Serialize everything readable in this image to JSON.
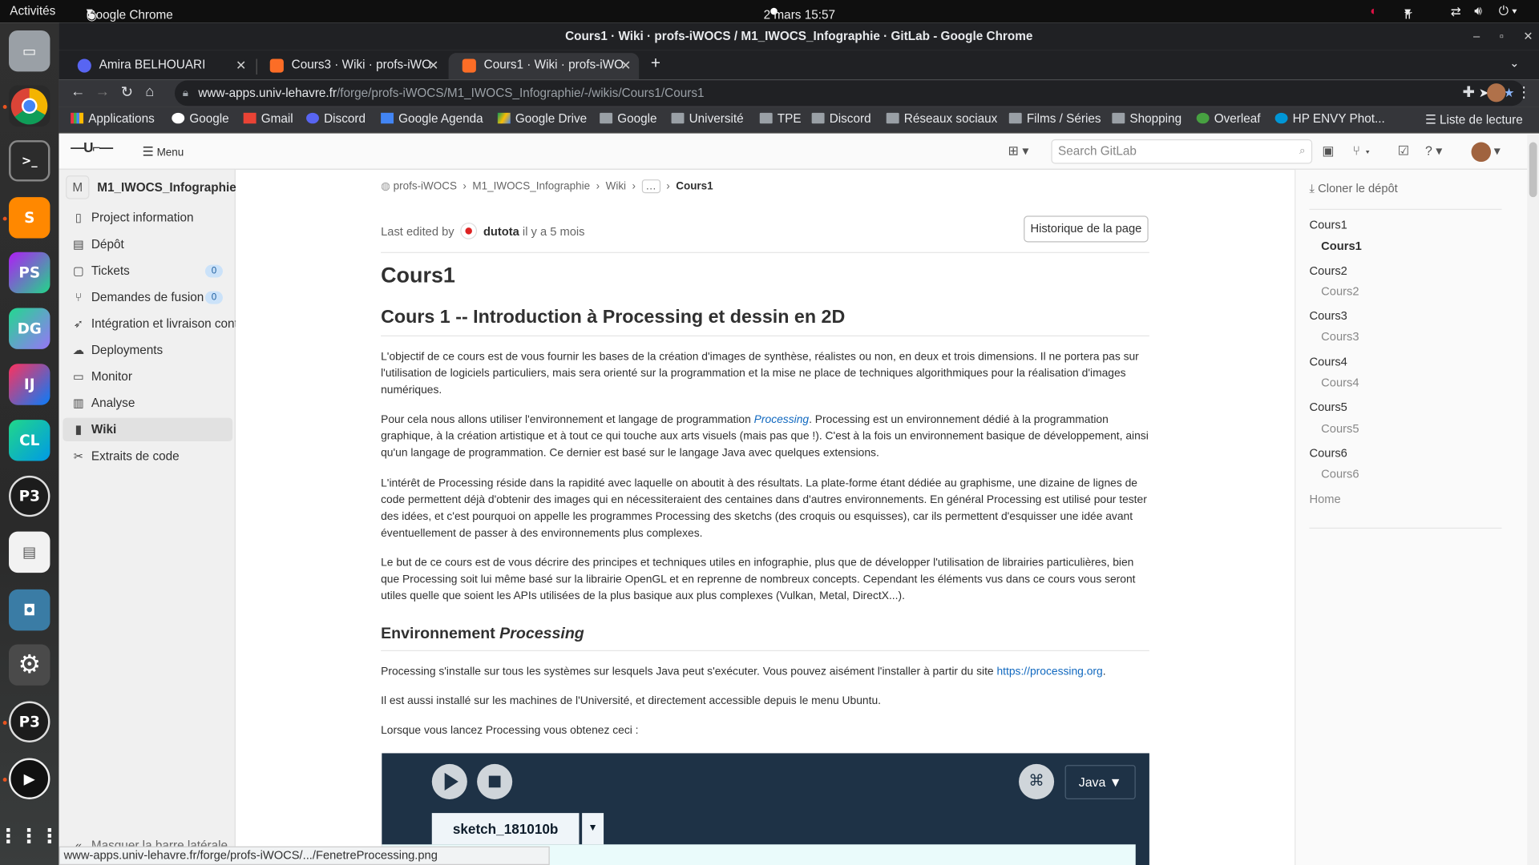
{
  "system": {
    "activities": "Activités",
    "app_menu": "Google Chrome",
    "clock": "2 mars  15:57",
    "lang": "fr"
  },
  "window": {
    "title": "Cours1 · Wiki · profs-iWOCS / M1_IWOCS_Infographie · GitLab - Google Chrome"
  },
  "tabs": [
    {
      "label": "Amira BELHOUARI",
      "favicon_color": "#5865f2"
    },
    {
      "label": "Cours3 · Wiki · profs-iWO",
      "favicon_color": "#fc6d26"
    },
    {
      "label": "Cours1 · Wiki · profs-iWO",
      "favicon_color": "#fc6d26"
    }
  ],
  "omnibox": {
    "domain": "www-apps.univ-lehavre.fr",
    "path": "/forge/profs-iWOCS/M1_IWOCS_Infographie/-/wikis/Cours1/Cours1"
  },
  "bookmarks": [
    {
      "label": "Applications",
      "icon": "apps-grid-icon"
    },
    {
      "label": "Google",
      "icon": "google-icon"
    },
    {
      "label": "Gmail",
      "icon": "gmail-icon"
    },
    {
      "label": "Discord",
      "icon": "discord-icon"
    },
    {
      "label": "Google Agenda",
      "icon": "calendar-icon"
    },
    {
      "label": "Google Drive",
      "icon": "drive-icon"
    },
    {
      "label": "Google",
      "icon": "folder-icon"
    },
    {
      "label": "Université",
      "icon": "folder-icon"
    },
    {
      "label": "TPE",
      "icon": "folder-icon"
    },
    {
      "label": "Discord",
      "icon": "folder-icon"
    },
    {
      "label": "Réseaux sociaux",
      "icon": "folder-icon"
    },
    {
      "label": "Films / Séries",
      "icon": "folder-icon"
    },
    {
      "label": "Shopping",
      "icon": "folder-icon"
    },
    {
      "label": "Overleaf",
      "icon": "overleaf-icon"
    },
    {
      "label": "HP ENVY Phot...",
      "icon": "hp-icon"
    }
  ],
  "reading_list": "Liste de lecture",
  "gitlab": {
    "menu_label": "Menu",
    "search_placeholder": "Search GitLab"
  },
  "sidebar": {
    "project_initial": "M",
    "project_name": "M1_IWOCS_Infographie",
    "items": [
      {
        "label": "Project information",
        "icon": "info-icon"
      },
      {
        "label": "Dépôt",
        "icon": "repository-icon"
      },
      {
        "label": "Tickets",
        "icon": "issues-icon",
        "count": "0"
      },
      {
        "label": "Demandes de fusion",
        "icon": "merge-request-icon",
        "count": "0"
      },
      {
        "label": "Intégration et livraison continue",
        "icon": "rocket-icon"
      },
      {
        "label": "Deployments",
        "icon": "deployments-icon"
      },
      {
        "label": "Monitor",
        "icon": "monitor-icon"
      },
      {
        "label": "Analyse",
        "icon": "chart-icon"
      },
      {
        "label": "Wiki",
        "icon": "book-icon"
      },
      {
        "label": "Extraits de code",
        "icon": "snippet-icon"
      }
    ],
    "collapse_label": "Masquer la barre latérale"
  },
  "breadcrumb": [
    "profs-iWOCS",
    "M1_IWOCS_Infographie",
    "Wiki",
    "Cours1"
  ],
  "last_edit": {
    "prefix": "Last edited by",
    "author": "dutota",
    "when": "il y a 5 mois"
  },
  "history_button": "Historique de la page",
  "content": {
    "page_title": "Cours1",
    "h2": "Cours 1 -- Introduction à Processing et dessin en 2D",
    "p1": "L'objectif de ce cours est de vous fournir les bases de la création d'images de synthèse, réalistes ou non, en deux et trois dimensions. Il ne portera pas sur l'utilisation de logiciels particuliers, mais sera orienté sur la programmation et la mise ne place de techniques algorithmiques pour la réalisation d'images numériques.",
    "p2_before": "Pour cela nous allons utiliser l'environnement et langage de programmation ",
    "p2_link": "Processing",
    "p2_after": ". Processing est un environnement dédié à la programmation graphique, à la création artistique et à tout ce qui touche aux arts visuels (mais pas que !). C'est à la fois un environnement basique de développement, ainsi qu'un langage de programmation. Ce dernier est basé sur le langage Java avec quelques extensions.",
    "p3": "L'intérêt de Processing réside dans la rapidité avec laquelle on aboutit à des résultats. La plate-forme étant dédiée au graphisme, une dizaine de lignes de code permettent déjà d'obtenir des images qui en nécessiteraient des centaines dans d'autres environnements. En général Processing est utilisé pour tester des idées, et c'est pourquoi on appelle les programmes Processing des sketchs (des croquis ou esquisses), car ils permettent d'esquisser une idée avant éventuellement de passer à des environnements plus complexes.",
    "p4": "Le but de ce cours est de vous décrire des principes et techniques utiles en infographie, plus que de développer l'utilisation de librairies particulières, bien que Processing soit lui même basé sur la librairie OpenGL et en reprenne de nombreux concepts. Cependant les éléments vus dans ce cours vous seront utiles quelle que soient les APIs utilisées de la plus basique aux plus complexes (Vulkan, Metal, DirectX...).",
    "h3_plain": "Environnement ",
    "h3_italic": "Processing",
    "p5_before": "Processing s'installe sur tous les systèmes sur lesquels Java peut s'exécuter. Vous pouvez aisément l'installer à partir du site ",
    "p5_link": "https://processing.org",
    "p5_after": ".",
    "p6": "Il est aussi installé sur les machines de l'Université, et directement accessible depuis le menu Ubuntu.",
    "p7": "Lorsque vous lancez Processing vous obtenez ceci :"
  },
  "sketch": {
    "tab_name": "sketch_181010b",
    "mode": "Java ▼"
  },
  "right_panel": {
    "clone": "Cloner le dépôt",
    "pages": [
      {
        "title": "Cours1",
        "sub": "Cours1"
      },
      {
        "title": "Cours2",
        "sub": "Cours2"
      },
      {
        "title": "Cours3",
        "sub": "Cours3"
      },
      {
        "title": "Cours4",
        "sub": "Cours4"
      },
      {
        "title": "Cours5",
        "sub": "Cours5"
      },
      {
        "title": "Cours6",
        "sub": "Cours6"
      }
    ],
    "home": "Home"
  },
  "status_url": "www-apps.univ-lehavre.fr/forge/profs-iWOCS/.../FenetreProcessing.png"
}
